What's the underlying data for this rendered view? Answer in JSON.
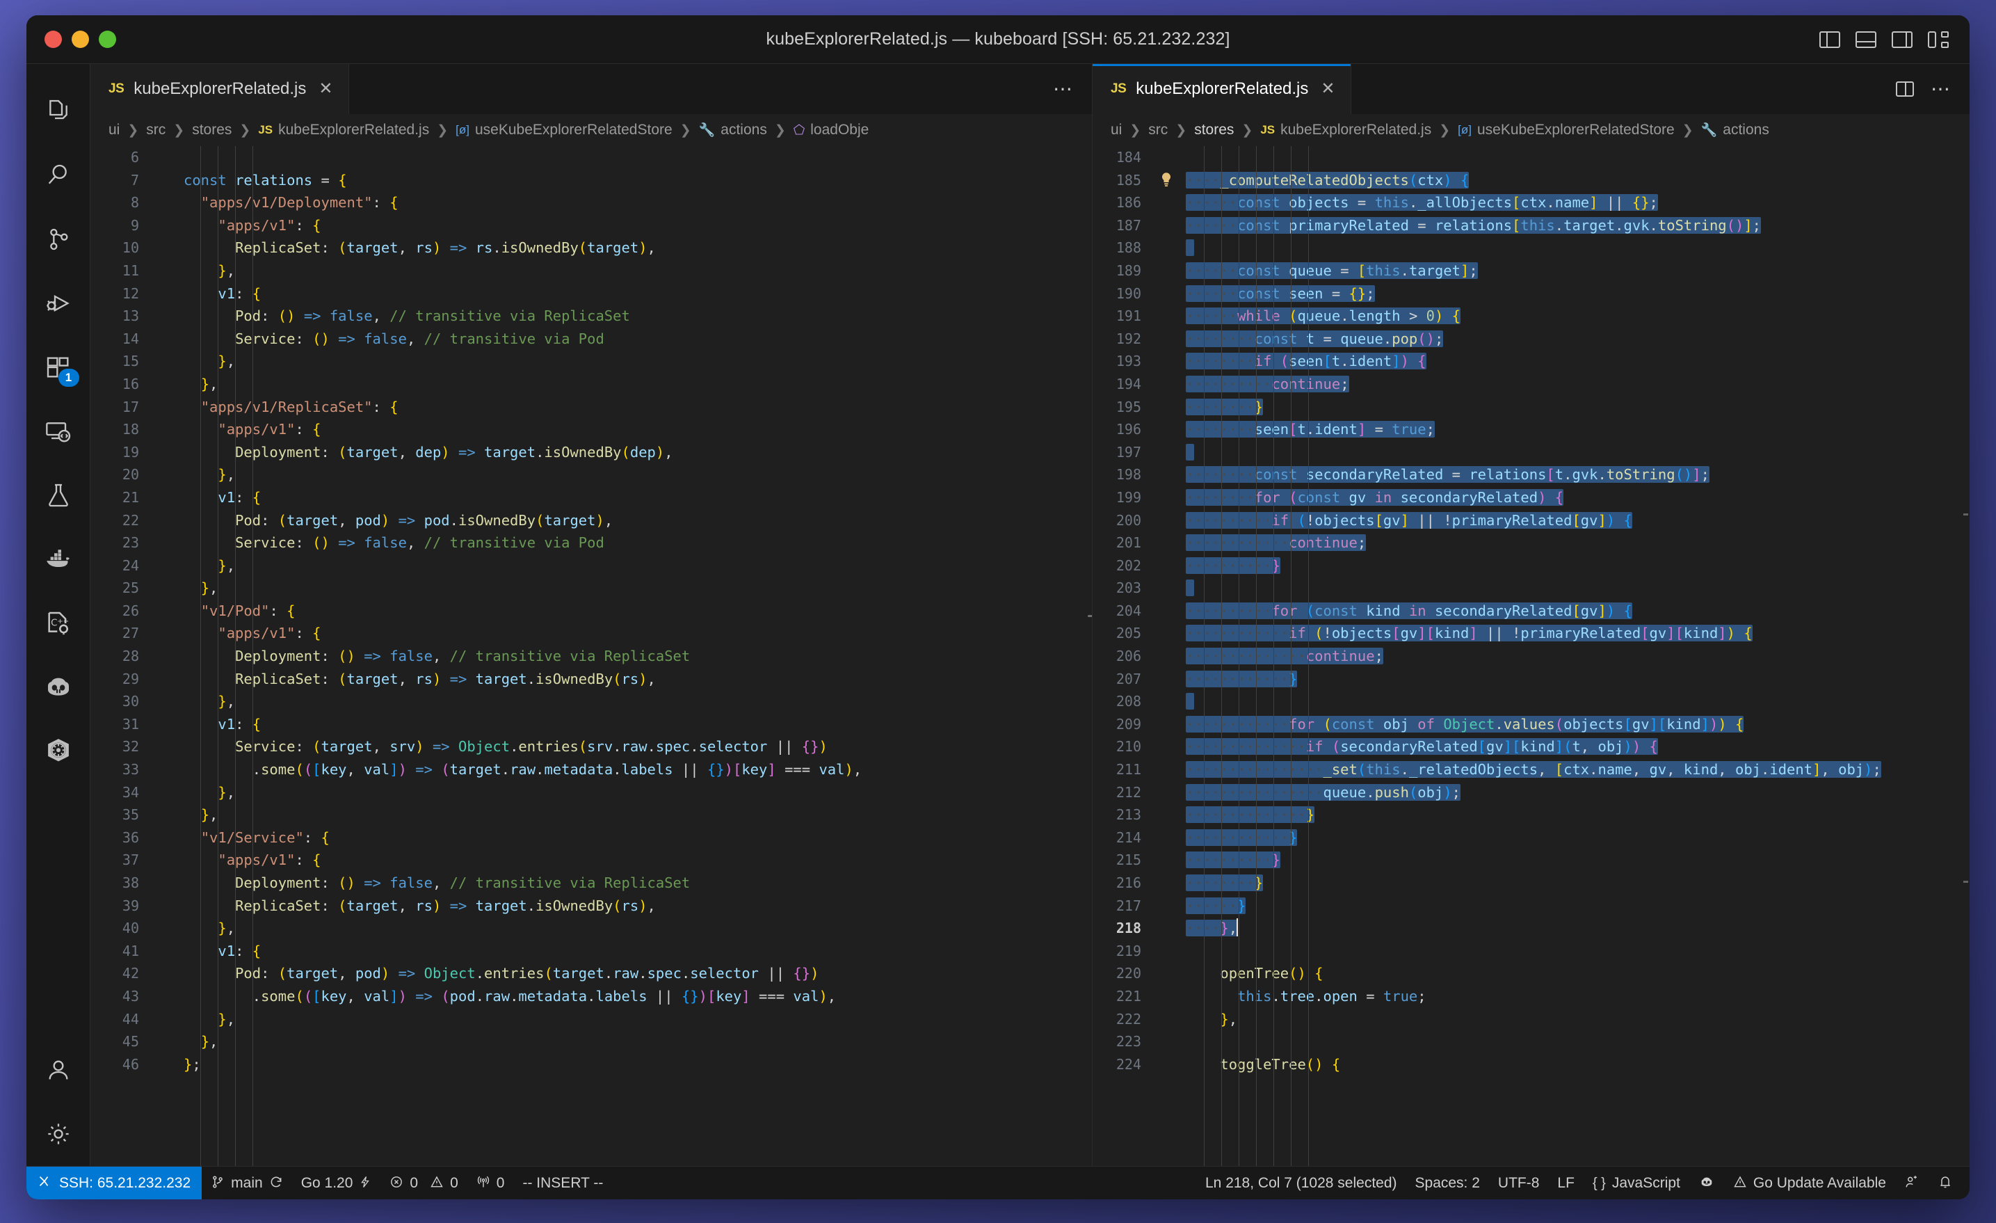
{
  "window": {
    "title": "kubeExplorerRelated.js — kubeboard [SSH: 65.21.232.232]",
    "titlebar_actions": [
      {
        "name": "toggle-primary-sidebar",
        "icon": "layout-sidebar-left-icon"
      },
      {
        "name": "toggle-panel",
        "icon": "layout-panel-icon"
      },
      {
        "name": "toggle-secondary-sidebar",
        "icon": "layout-sidebar-right-icon"
      },
      {
        "name": "customize-layout",
        "icon": "layout-custom-icon"
      }
    ]
  },
  "activitybar": {
    "items": [
      {
        "name": "explorer",
        "icon": "files-icon",
        "badge": ""
      },
      {
        "name": "search",
        "icon": "search-icon",
        "badge": ""
      },
      {
        "name": "source-control",
        "icon": "source-control-icon",
        "badge": ""
      },
      {
        "name": "run-and-debug",
        "icon": "run-debug-icon",
        "badge": ""
      },
      {
        "name": "extensions",
        "icon": "extensions-icon",
        "badge": "1"
      },
      {
        "name": "remote-explorer",
        "icon": "remote-explorer-icon",
        "badge": ""
      },
      {
        "name": "testing",
        "icon": "beaker-icon",
        "badge": ""
      },
      {
        "name": "docker",
        "icon": "docker-icon",
        "badge": ""
      },
      {
        "name": "cpp-tools",
        "icon": "cpp-gear-icon",
        "badge": ""
      },
      {
        "name": "copilot",
        "icon": "copilot-icon",
        "badge": ""
      },
      {
        "name": "kubernetes",
        "icon": "kubernetes-icon",
        "badge": ""
      }
    ],
    "bottom": [
      {
        "name": "accounts",
        "icon": "account-icon"
      },
      {
        "name": "manage-settings",
        "icon": "gear-icon"
      }
    ]
  },
  "editor_groups": {
    "left": {
      "tab": {
        "label": "kubeExplorerRelated.js",
        "icon": "js-file-icon",
        "badge": "JS",
        "close": "✕",
        "active": false
      },
      "tab_actions": [
        {
          "name": "more-actions",
          "icon": "ellipsis-icon",
          "label": "⋯"
        }
      ],
      "breadcrumb": [
        {
          "label": "ui",
          "icon": ""
        },
        {
          "label": "src",
          "icon": ""
        },
        {
          "label": "stores",
          "icon": ""
        },
        {
          "label": "kubeExplorerRelated.js",
          "icon": "js-file-icon"
        },
        {
          "label": "useKubeExplorerRelatedStore",
          "icon": "interface-icon"
        },
        {
          "label": "actions",
          "icon": "wrench-icon"
        },
        {
          "label": "loadObje",
          "icon": "field-icon"
        }
      ],
      "first_line": 6,
      "lines": [
        {
          "n": 6,
          "text": ""
        },
        {
          "n": 7,
          "text": "const relations = {"
        },
        {
          "n": 8,
          "text": "  \"apps/v1/Deployment\": {"
        },
        {
          "n": 9,
          "text": "    \"apps/v1\": {"
        },
        {
          "n": 10,
          "text": "      ReplicaSet: (target, rs) => rs.isOwnedBy(target),"
        },
        {
          "n": 11,
          "text": "    },"
        },
        {
          "n": 12,
          "text": "    v1: {"
        },
        {
          "n": 13,
          "text": "      Pod: () => false, // transitive via ReplicaSet"
        },
        {
          "n": 14,
          "text": "      Service: () => false, // transitive via Pod"
        },
        {
          "n": 15,
          "text": "    },"
        },
        {
          "n": 16,
          "text": "  },"
        },
        {
          "n": 17,
          "text": "  \"apps/v1/ReplicaSet\": {"
        },
        {
          "n": 18,
          "text": "    \"apps/v1\": {"
        },
        {
          "n": 19,
          "text": "      Deployment: (target, dep) => target.isOwnedBy(dep),"
        },
        {
          "n": 20,
          "text": "    },"
        },
        {
          "n": 21,
          "text": "    v1: {"
        },
        {
          "n": 22,
          "text": "      Pod: (target, pod) => pod.isOwnedBy(target),"
        },
        {
          "n": 23,
          "text": "      Service: () => false, // transitive via Pod"
        },
        {
          "n": 24,
          "text": "    },"
        },
        {
          "n": 25,
          "text": "  },"
        },
        {
          "n": 26,
          "text": "  \"v1/Pod\": {"
        },
        {
          "n": 27,
          "text": "    \"apps/v1\": {"
        },
        {
          "n": 28,
          "text": "      Deployment: () => false, // transitive via ReplicaSet"
        },
        {
          "n": 29,
          "text": "      ReplicaSet: (target, rs) => target.isOwnedBy(rs),"
        },
        {
          "n": 30,
          "text": "    },"
        },
        {
          "n": 31,
          "text": "    v1: {"
        },
        {
          "n": 32,
          "text": "      Service: (target, srv) => Object.entries(srv.raw.spec.selector || {})"
        },
        {
          "n": 33,
          "text": "        .some(([key, val]) => (target.raw.metadata.labels || {})[key] === val),"
        },
        {
          "n": 34,
          "text": "    },"
        },
        {
          "n": 35,
          "text": "  },"
        },
        {
          "n": 36,
          "text": "  \"v1/Service\": {"
        },
        {
          "n": 37,
          "text": "    \"apps/v1\": {"
        },
        {
          "n": 38,
          "text": "      Deployment: () => false, // transitive via ReplicaSet"
        },
        {
          "n": 39,
          "text": "      ReplicaSet: (target, rs) => target.isOwnedBy(rs),"
        },
        {
          "n": 40,
          "text": "    },"
        },
        {
          "n": 41,
          "text": "    v1: {"
        },
        {
          "n": 42,
          "text": "      Pod: (target, pod) => Object.entries(target.raw.spec.selector || {})"
        },
        {
          "n": 43,
          "text": "        .some(([key, val]) => (pod.raw.metadata.labels || {})[key] === val),"
        },
        {
          "n": 44,
          "text": "    },"
        },
        {
          "n": 45,
          "text": "  },"
        },
        {
          "n": 46,
          "text": "};"
        }
      ]
    },
    "right": {
      "tab": {
        "label": "kubeExplorerRelated.js",
        "icon": "js-file-icon",
        "badge": "JS",
        "close": "✕",
        "active": true
      },
      "tab_actions": [
        {
          "name": "split-editor",
          "icon": "split-editor-icon"
        },
        {
          "name": "more-actions",
          "icon": "ellipsis-icon",
          "label": "⋯"
        }
      ],
      "breadcrumb": [
        {
          "label": "ui",
          "icon": ""
        },
        {
          "label": "src",
          "icon": ""
        },
        {
          "label": "stores",
          "icon": ""
        },
        {
          "label": "kubeExplorerRelated.js",
          "icon": "js-file-icon"
        },
        {
          "label": "useKubeExplorerRelatedStore",
          "icon": "interface-icon"
        },
        {
          "label": "actions",
          "icon": "wrench-icon"
        }
      ],
      "first_line": 184,
      "lines": [
        {
          "n": 184,
          "text": "",
          "sel": false
        },
        {
          "n": 185,
          "text": "    _computeRelatedObjects(ctx) {",
          "sel": true,
          "bulb": true
        },
        {
          "n": 186,
          "text": "      const objects = this._allObjects[ctx.name] || {};",
          "sel": true
        },
        {
          "n": 187,
          "text": "      const primaryRelated = relations[this.target.gvk.toString()];",
          "sel": true
        },
        {
          "n": 188,
          "text": "",
          "sel": true
        },
        {
          "n": 189,
          "text": "      const queue = [this.target];",
          "sel": true
        },
        {
          "n": 190,
          "text": "      const seen = {};",
          "sel": true
        },
        {
          "n": 191,
          "text": "      while (queue.length > 0) {",
          "sel": true
        },
        {
          "n": 192,
          "text": "        const t = queue.pop();",
          "sel": true
        },
        {
          "n": 193,
          "text": "        if (seen[t.ident]) {",
          "sel": true
        },
        {
          "n": 194,
          "text": "          continue;",
          "sel": true
        },
        {
          "n": 195,
          "text": "        }",
          "sel": true
        },
        {
          "n": 196,
          "text": "        seen[t.ident] = true;",
          "sel": true
        },
        {
          "n": 197,
          "text": "",
          "sel": true
        },
        {
          "n": 198,
          "text": "        const secondaryRelated = relations[t.gvk.toString()];",
          "sel": true
        },
        {
          "n": 199,
          "text": "        for (const gv in secondaryRelated) {",
          "sel": true
        },
        {
          "n": 200,
          "text": "          if (!objects[gv] || !primaryRelated[gv]) {",
          "sel": true
        },
        {
          "n": 201,
          "text": "            continue;",
          "sel": true
        },
        {
          "n": 202,
          "text": "          }",
          "sel": true
        },
        {
          "n": 203,
          "text": "",
          "sel": true
        },
        {
          "n": 204,
          "text": "          for (const kind in secondaryRelated[gv]) {",
          "sel": true
        },
        {
          "n": 205,
          "text": "            if (!objects[gv][kind] || !primaryRelated[gv][kind]) {",
          "sel": true
        },
        {
          "n": 206,
          "text": "              continue;",
          "sel": true
        },
        {
          "n": 207,
          "text": "            }",
          "sel": true
        },
        {
          "n": 208,
          "text": "",
          "sel": true
        },
        {
          "n": 209,
          "text": "            for (const obj of Object.values(objects[gv][kind])) {",
          "sel": true
        },
        {
          "n": 210,
          "text": "              if (secondaryRelated[gv][kind](t, obj)) {",
          "sel": true
        },
        {
          "n": 211,
          "text": "                _set(this._relatedObjects, [ctx.name, gv, kind, obj.ident], obj);",
          "sel": true
        },
        {
          "n": 212,
          "text": "                queue.push(obj);",
          "sel": true
        },
        {
          "n": 213,
          "text": "              }",
          "sel": true
        },
        {
          "n": 214,
          "text": "            }",
          "sel": true
        },
        {
          "n": 215,
          "text": "          }",
          "sel": true
        },
        {
          "n": 216,
          "text": "        }",
          "sel": true
        },
        {
          "n": 217,
          "text": "      }",
          "sel": true
        },
        {
          "n": 218,
          "text": "    },",
          "sel": true,
          "cursor": true,
          "current": true
        },
        {
          "n": 219,
          "text": "",
          "sel": false
        },
        {
          "n": 220,
          "text": "    openTree() {",
          "sel": false
        },
        {
          "n": 221,
          "text": "      this.tree.open = true;",
          "sel": false
        },
        {
          "n": 222,
          "text": "    },",
          "sel": false
        },
        {
          "n": 223,
          "text": "",
          "sel": false
        },
        {
          "n": 224,
          "text": "    toggleTree() {",
          "sel": false
        }
      ]
    }
  },
  "statusbar": {
    "remote": {
      "label": "SSH: 65.21.232.232",
      "icon": "remote-icon",
      "color": "#0078d4"
    },
    "left_items": [
      {
        "name": "branch",
        "icon": "git-branch-icon",
        "label": "main",
        "trailing_icon": "sync-icon"
      },
      {
        "name": "go-version",
        "icon": "",
        "label": "Go 1.20",
        "trailing_icon": "zap-icon"
      },
      {
        "name": "problems",
        "icon": "error-icon",
        "label": "0",
        "second_icon": "warning-icon",
        "second_label": "0"
      },
      {
        "name": "ports",
        "icon": "radio-tower-icon",
        "label": "0"
      },
      {
        "name": "vim-mode",
        "icon": "",
        "label": "-- INSERT --"
      }
    ],
    "right_items": [
      {
        "name": "cursor-position",
        "label": "Ln 218, Col 7 (1028 selected)"
      },
      {
        "name": "indentation",
        "label": "Spaces: 2"
      },
      {
        "name": "encoding",
        "label": "UTF-8"
      },
      {
        "name": "eol",
        "label": "LF"
      },
      {
        "name": "language-mode",
        "icon": "braces-icon",
        "label": "JavaScript"
      },
      {
        "name": "copilot-status",
        "icon": "copilot-icon",
        "label": ""
      },
      {
        "name": "go-update",
        "icon": "warning-icon",
        "label": "Go Update Available"
      },
      {
        "name": "remote-account",
        "icon": "person-add-icon",
        "label": ""
      },
      {
        "name": "notifications",
        "icon": "bell-icon",
        "label": ""
      }
    ]
  }
}
